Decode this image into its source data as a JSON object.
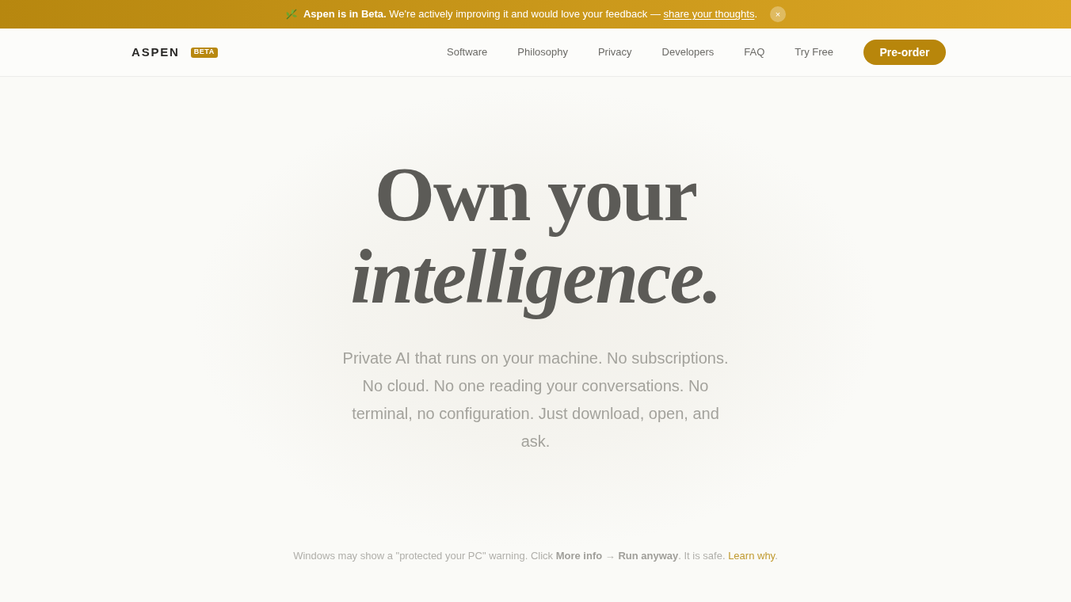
{
  "banner": {
    "message": "**Aspen is in Beta.** We're actively improving it and would love your feedback —",
    "link": "share your thoughts",
    "after_link": ".",
    "close": "×"
  },
  "nav": {
    "logo": "ASPEN",
    "badge": "BETA",
    "links": [
      {
        "label": "Software"
      },
      {
        "label": "Philosophy"
      },
      {
        "label": "Privacy"
      },
      {
        "label": "Developers"
      },
      {
        "label": "FAQ"
      },
      {
        "label": "Try Free"
      }
    ],
    "cta": "Pre-order"
  },
  "hero": {
    "headline": [
      {
        "text": "Own your",
        "italic": false
      },
      {
        "text": "intelligence.",
        "italic": true
      }
    ],
    "subtitle": "Private AI that runs on your machine. No subscriptions. No cloud. No one reading your conversations. No terminal, no configuration. Just download, open, and ask."
  },
  "notice": {
    "text": "Windows may show a \"protected your PC\" warning. Click **More info** → **Run anyway**. It is safe.",
    "link": "Learn why",
    "after_link": "."
  }
}
